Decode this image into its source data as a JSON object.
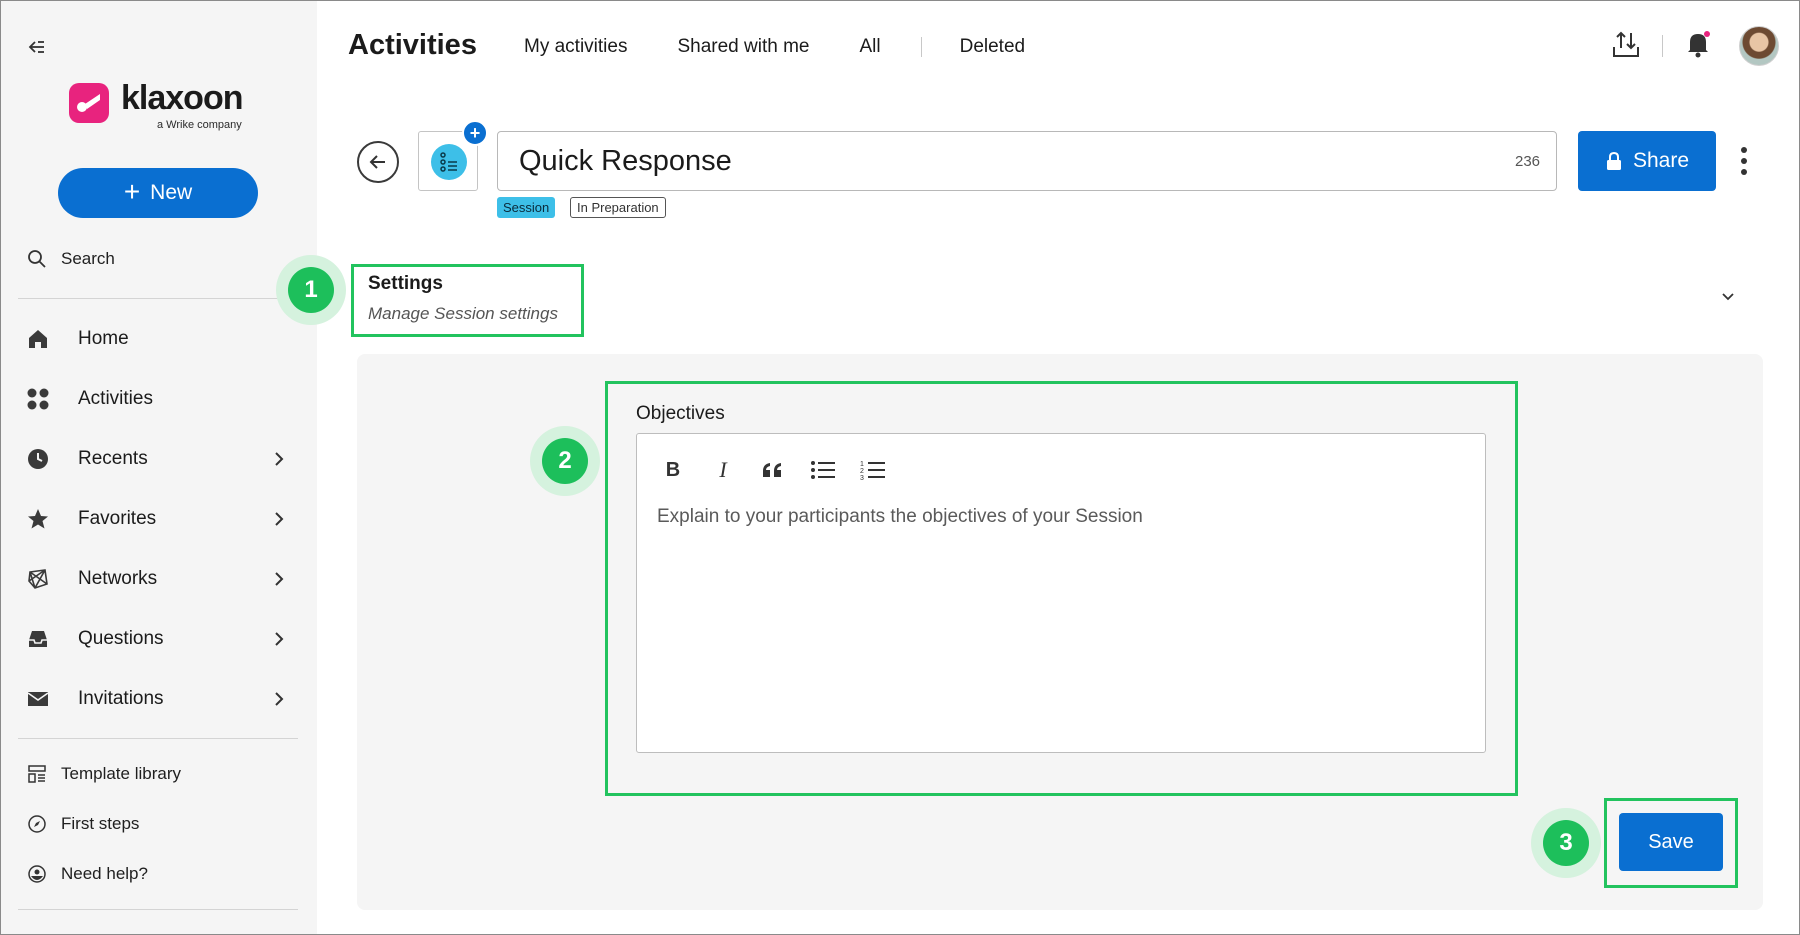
{
  "brand": {
    "name": "klaxoon",
    "tagline": "a Wrike company",
    "color": "#e8237e"
  },
  "sidebar": {
    "new_label": "New",
    "search_label": "Search",
    "items": [
      {
        "label": "Home",
        "icon": "home-icon"
      },
      {
        "label": "Activities",
        "icon": "activities-icon"
      },
      {
        "label": "Recents",
        "icon": "clock-icon"
      },
      {
        "label": "Favorites",
        "icon": "star-icon"
      },
      {
        "label": "Networks",
        "icon": "network-icon"
      },
      {
        "label": "Questions",
        "icon": "inbox-icon"
      },
      {
        "label": "Invitations",
        "icon": "mail-icon"
      }
    ],
    "footer": [
      {
        "label": "Template library",
        "icon": "template-icon"
      },
      {
        "label": "First steps",
        "icon": "compass-icon"
      },
      {
        "label": "Need help?",
        "icon": "help-icon"
      }
    ]
  },
  "header": {
    "title": "Activities",
    "tabs": [
      "My activities",
      "Shared with me",
      "All",
      "Deleted"
    ]
  },
  "activity": {
    "title": "Quick Response",
    "char_count": "236",
    "type_badge": "Session",
    "status_badge": "In Preparation",
    "share_label": "Share"
  },
  "settings": {
    "title": "Settings",
    "subtitle": "Manage Session settings",
    "objectives_label": "Objectives",
    "objectives_placeholder": "Explain to your participants the objectives of your Session",
    "save_label": "Save"
  },
  "steps": [
    "1",
    "2",
    "3"
  ],
  "colors": {
    "accent": "#0a6fd1",
    "highlight": "#22c35e",
    "session_badge": "#3dbfe8",
    "notification_dot": "#e8237e"
  }
}
